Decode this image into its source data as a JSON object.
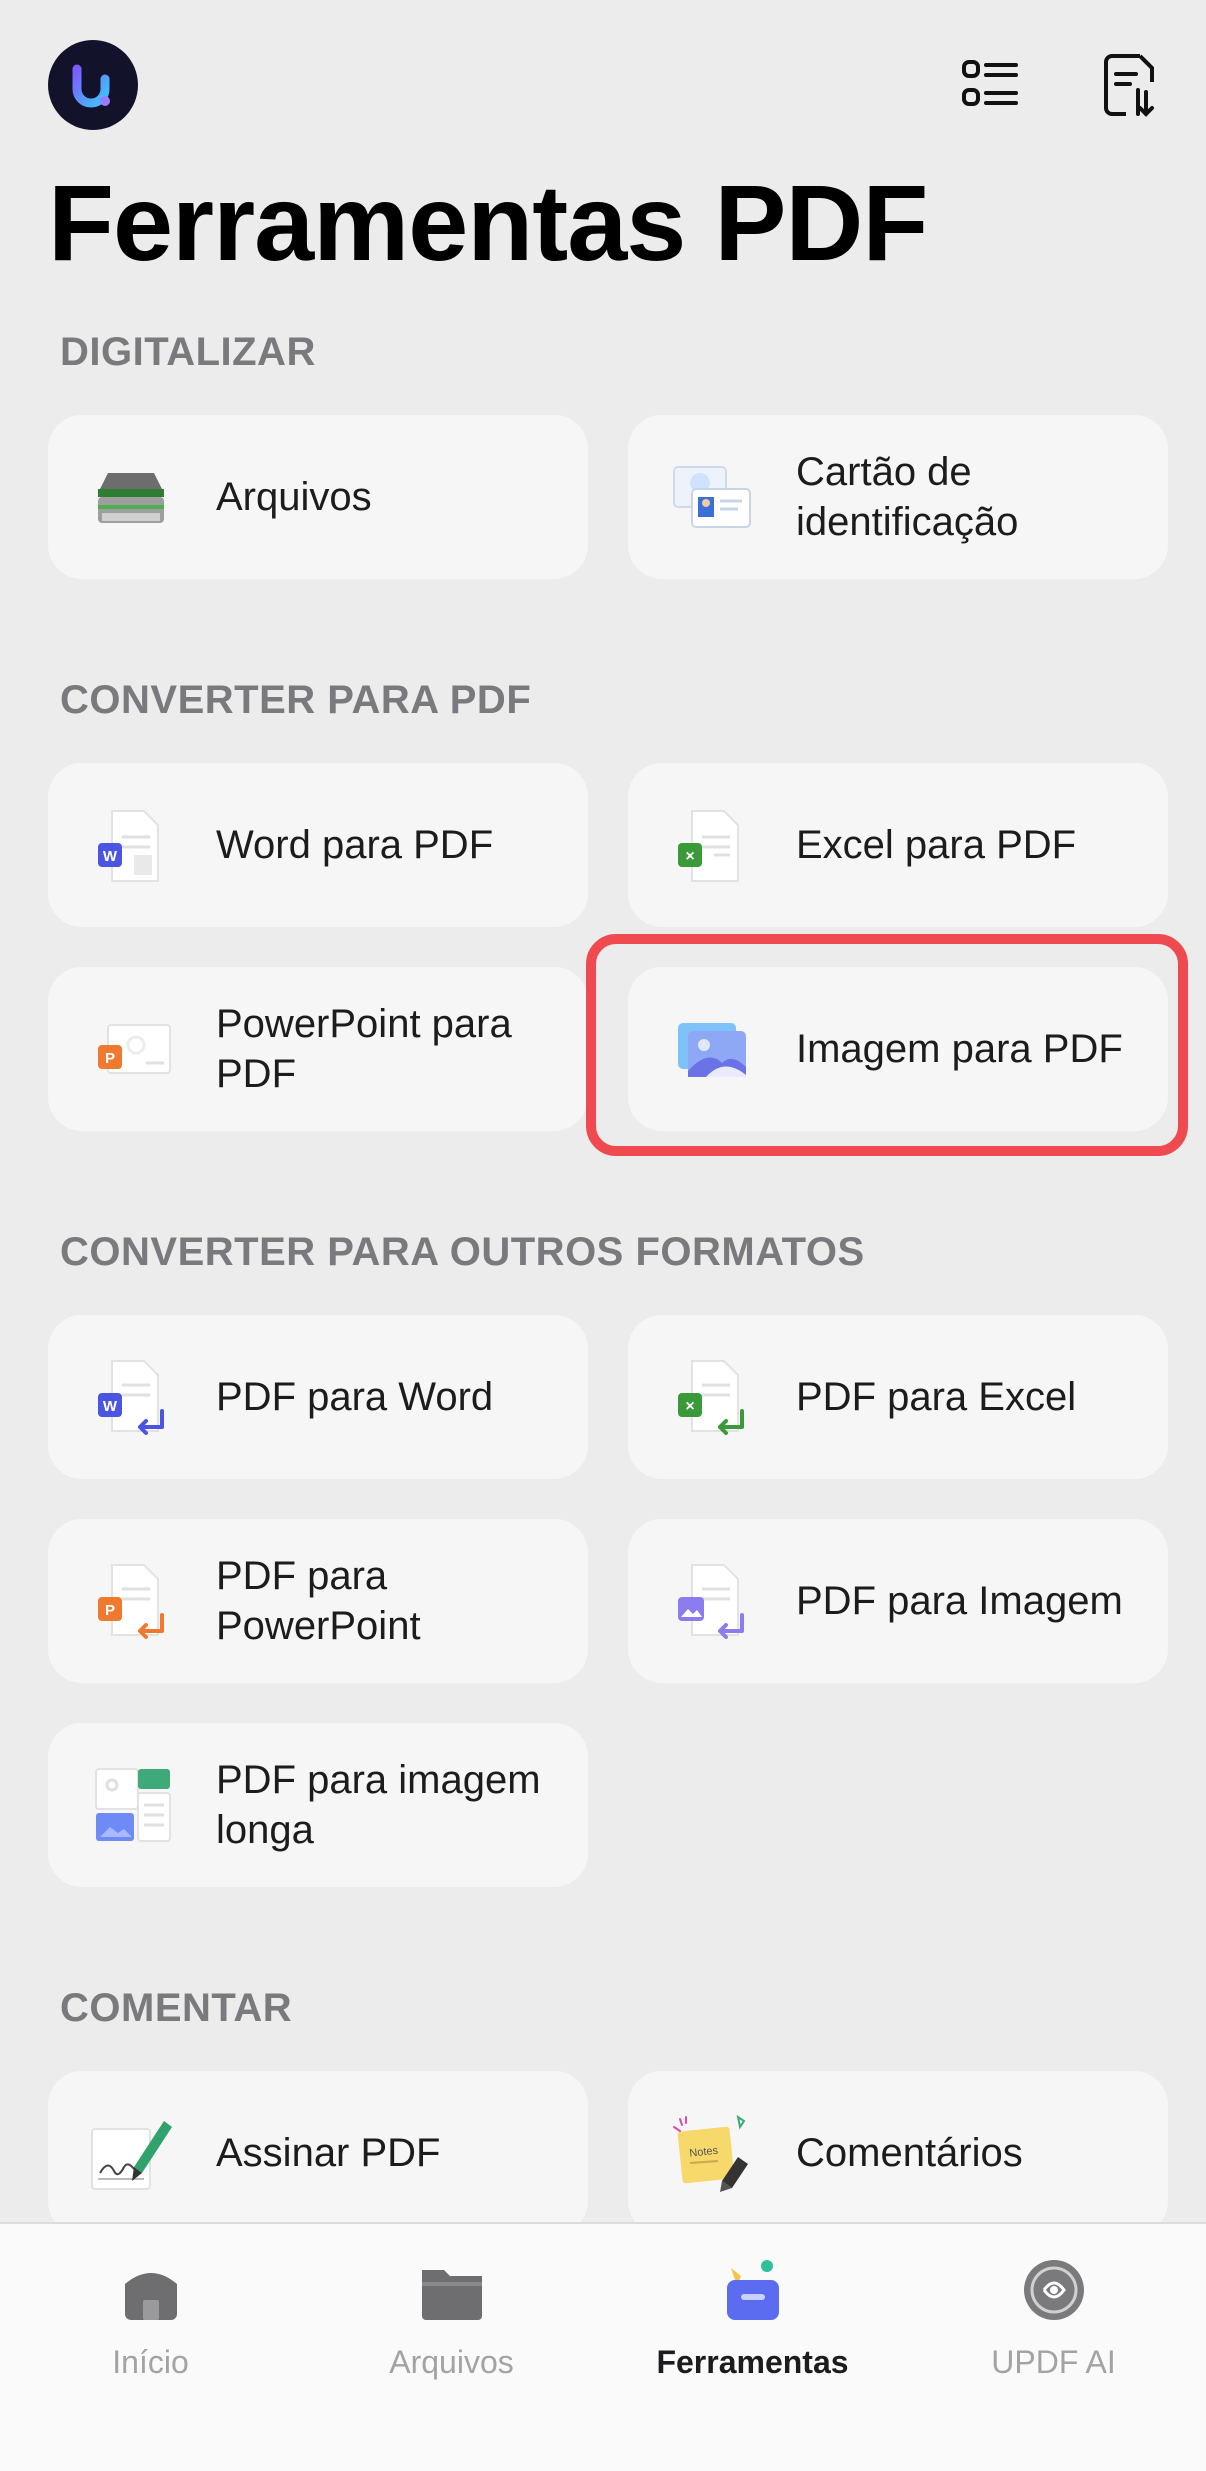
{
  "header": {
    "title": "Ferramentas PDF",
    "logo_icon": "updf-logo-icon",
    "list_icon": "list-icon",
    "sort_icon": "document-sort-icon"
  },
  "sections": {
    "scan": {
      "title": "DIGITALIZAR",
      "items": [
        "Arquivos",
        "Cartão de identificação"
      ]
    },
    "to_pdf": {
      "title": "CONVERTER PARA PDF",
      "items": [
        "Word para PDF",
        "Excel para PDF",
        "PowerPoint para PDF",
        "Imagem para PDF"
      ]
    },
    "from_pdf": {
      "title": "CONVERTER PARA OUTROS FORMATOS",
      "items": [
        "PDF para Word",
        "PDF para Excel",
        "PDF para PowerPoint",
        "PDF para Imagem",
        "PDF para imagem longa"
      ]
    },
    "comment": {
      "title": "COMENTAR",
      "items": [
        "Assinar PDF",
        "Comentários"
      ]
    }
  },
  "tabbar": {
    "items": [
      "Início",
      "Arquivos",
      "Ferramentas",
      "UPDF AI"
    ],
    "active": "Ferramentas"
  },
  "colors": {
    "background": "#ececec",
    "card": "#f6f6f6",
    "highlight": "#ee4a4f",
    "word": "#4a56e2",
    "excel": "#3a9a3a",
    "powerpoint": "#ef7a2f",
    "image": "#8b7cf0"
  }
}
